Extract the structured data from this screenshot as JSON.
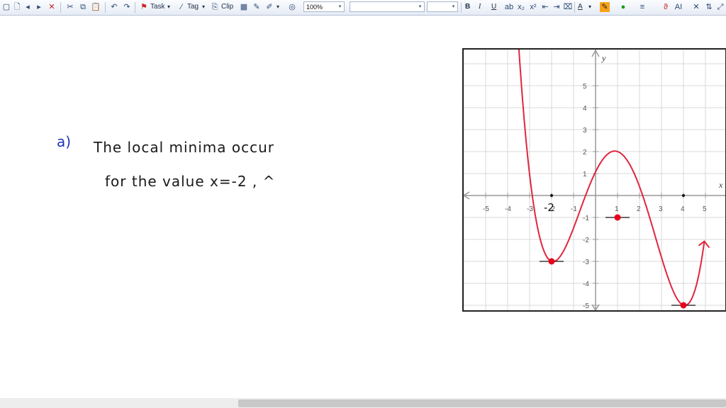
{
  "toolbar": {
    "task_label": "Task",
    "tag_label": "Tag",
    "clip_label": "Clip",
    "zoom_value": "100%",
    "font_value": "",
    "size_value": "",
    "bold": "B",
    "italic": "I",
    "underline": "U",
    "font_a": "A"
  },
  "notes": {
    "part": "a)",
    "line1": "The local minima occur",
    "line2": "for the value x=-2 , ^"
  },
  "graph": {
    "x_axis_label": "x",
    "y_axis_label": "y",
    "x_ticks": [
      "-5",
      "-4",
      "-3",
      "-2",
      "-1",
      "1",
      "2",
      "3",
      "4",
      "5"
    ],
    "y_ticks": [
      "5",
      "4",
      "3",
      "2",
      "1",
      "-1",
      "-2",
      "-3",
      "-4",
      "-5"
    ],
    "handwritten_mark": "-2",
    "points": [
      {
        "x": -2,
        "y": -3
      },
      {
        "x": 1,
        "y": -1
      },
      {
        "x": 4,
        "y": -5
      }
    ],
    "curve_color": "#e0263d",
    "point_color": "#e8001c"
  }
}
